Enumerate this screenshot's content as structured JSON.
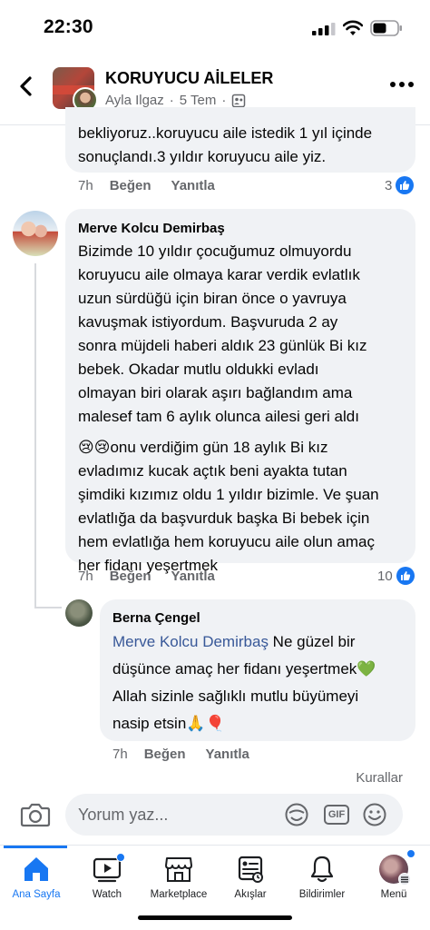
{
  "status": {
    "time": "22:30"
  },
  "header": {
    "title": "KORUYUCU AİLELER",
    "author": "Ayla Ilgaz",
    "date": "5 Tem"
  },
  "comment1": {
    "text_line1": "bekliyoruz..koruyucu aile istedik 1 yıl içinde",
    "text_line2": "sonuçlandı.3 yıldır koruyucu aile yiz.",
    "time": "7h",
    "like_label": "Beğen",
    "reply_label": "Yanıtla",
    "likes": "3"
  },
  "comment2": {
    "author": "Merve Kolcu Demirbaş",
    "lines": [
      "Bizimde 10 yıldır çocuğumuz olmuyordu",
      "koruyucu aile olmaya karar verdik evlatlık",
      "uzun sürdüğü için biran önce o yavruya",
      "kavuşmak istiyordum. Başvuruda 2 ay",
      "sonra müjdeli haberi aldık 23 günlük Bi kız",
      "bebek. Okadar mutlu oldukki evladı",
      "olmayan biri olarak aşırı bağlandım ama",
      "malesef tam 6 aylık olunca ailesi geri aldı",
      "😢😢onu verdiğim gün 18 aylık Bi kız",
      "evladımız kucak açtık beni ayakta tutan",
      "şimdiki kızımız oldu 1 yıldır bizimle. Ve şuan",
      "evlatlığa da başvurduk başka Bi bebek için",
      "hem evlatlığa hem koruyucu aile olun amaç",
      "her fidanı yeşertmek"
    ],
    "time": "7h",
    "like_label": "Beğen",
    "reply_label": "Yanıtla",
    "likes": "10"
  },
  "reply1": {
    "author": "Berna Çengel",
    "mention": "Merve Kolcu Demirbaş",
    "line1_rest": " Ne güzel bir",
    "line2": "düşünce amaç her fidanı yeşertmek💚",
    "line3": "Allah sizinle sağlıklı mutlu büyümeyi",
    "line4": "nasip etsin🙏🎈",
    "time": "7h",
    "like_label": "Beğen",
    "reply_label": "Yanıtla"
  },
  "composer": {
    "rules_label": "Kurallar",
    "placeholder": "Yorum yaz...",
    "gif_label": "GIF"
  },
  "tabs": [
    {
      "label": "Ana Sayfa",
      "icon": "home-icon"
    },
    {
      "label": "Watch",
      "icon": "watch-icon"
    },
    {
      "label": "Marketplace",
      "icon": "marketplace-icon"
    },
    {
      "label": "Akışlar",
      "icon": "feeds-icon"
    },
    {
      "label": "Bildirimler",
      "icon": "bell-icon"
    },
    {
      "label": "Menü",
      "icon": "menu-avatar-icon"
    }
  ],
  "colors": {
    "accent": "#1877f2",
    "bubble": "#f0f2f5",
    "muted": "#65676b",
    "mention": "#385898"
  }
}
